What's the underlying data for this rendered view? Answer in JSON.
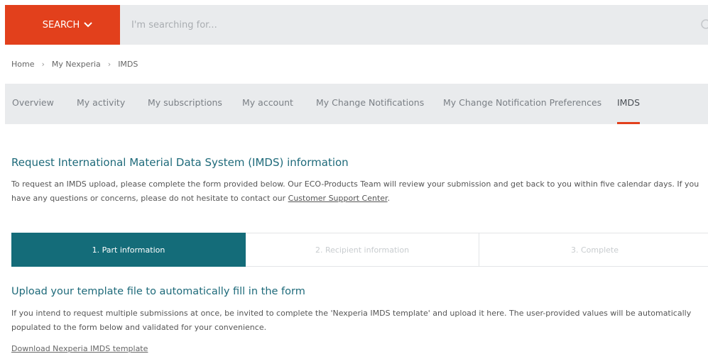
{
  "search": {
    "button_label": "SEARCH",
    "placeholder": "I'm searching for..."
  },
  "breadcrumb": [
    "Home",
    "My Nexperia",
    "IMDS"
  ],
  "tabs": [
    "Overview",
    "My activity",
    "My subscriptions",
    "My account",
    "My Change Notifications",
    "My Change Notification Preferences",
    "IMDS"
  ],
  "active_tab": "IMDS",
  "main": {
    "title": "Request International Material Data System (IMDS) information",
    "intro_text": "To request an IMDS upload, please complete the form provided below. Our ECO-Products Team will review your submission and get back to you within five calendar days. If you have any questions or concerns, please do not hesitate to contact our ",
    "support_link": "Customer Support Center",
    "intro_end": "."
  },
  "steps": [
    "1. Part information",
    "2. Recipient information",
    "3. Complete"
  ],
  "upload": {
    "title": "Upload your template file to automatically fill in the form",
    "text": "If you intend to request multiple submissions at once, be invited to complete the 'Nexperia IMDS template' and upload it here. The user-provided values will be automatically populated to the form below and validated for your convenience.",
    "download_link": "Download Nexperia IMDS template"
  },
  "colors": {
    "accent": "#e2401c",
    "teal": "#146c79",
    "bar_bg": "#e9ebed"
  },
  "icons": [
    "chevron-down-icon",
    "search-icon"
  ]
}
